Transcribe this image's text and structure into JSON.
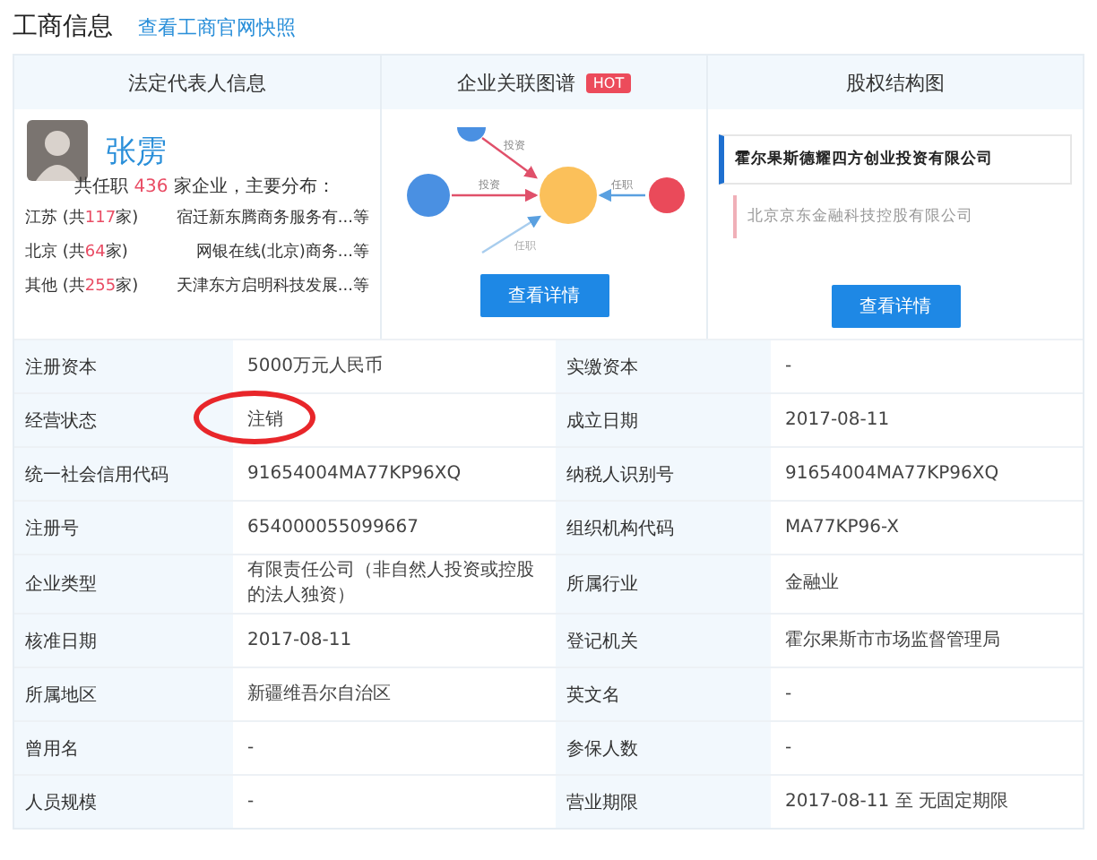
{
  "title": "工商信息",
  "snapshot_link": "查看工商官网快照",
  "panels": [
    {
      "kind": "person",
      "title": "法定代表人信息"
    },
    {
      "kind": "graph",
      "title": "企业关联图谱",
      "badge": "HOT",
      "button": "查看详情"
    },
    {
      "kind": "equity",
      "title": "股权结构图",
      "button": "查看详情"
    }
  ],
  "person": {
    "name": "张雳",
    "summary": {
      "before": "共任职",
      "count": "436",
      "after": "家企业，主要分布："
    },
    "regions": [
      {
        "region": "江苏 (共",
        "count": "117",
        "close": "家)",
        "company": "宿迁新东腾商务服务有...等"
      },
      {
        "region": "北京 (共",
        "count": "64",
        "close": "家)",
        "company": "网银在线(北京)商务...等"
      },
      {
        "region": "其他 (共",
        "count": "255",
        "close": "家)",
        "company": "天津东方启明科技发展...等"
      }
    ]
  },
  "graph": {
    "edge_labels": [
      "投资",
      "投资",
      "任职",
      "任职"
    ]
  },
  "equity": {
    "companies": [
      "霍尔果斯德耀四方创业投资有限公司",
      "北京京东金融科技控股有限公司"
    ]
  },
  "rows": [
    {
      "cells": [
        {
          "label": "注册资本",
          "value": "5000万元人民币"
        },
        {
          "label": "实缴资本",
          "value": "-"
        }
      ]
    },
    {
      "cells": [
        {
          "label": "经营状态",
          "value": "注销",
          "circled": true
        },
        {
          "label": "成立日期",
          "value": "2017-08-11"
        }
      ]
    },
    {
      "cells": [
        {
          "label": "统一社会信用代码",
          "value": "91654004MA77KP96XQ"
        },
        {
          "label": "纳税人识别号",
          "value": "91654004MA77KP96XQ"
        }
      ]
    },
    {
      "cells": [
        {
          "label": "注册号",
          "value": "654000055099667"
        },
        {
          "label": "组织机构代码",
          "value": "MA77KP96-X"
        }
      ]
    },
    {
      "cells": [
        {
          "label": "企业类型",
          "value": "有限责任公司（非自然人投资或控股的法人独资）"
        },
        {
          "label": "所属行业",
          "value": "金融业"
        }
      ]
    },
    {
      "cells": [
        {
          "label": "核准日期",
          "value": "2017-08-11"
        },
        {
          "label": "登记机关",
          "value": "霍尔果斯市市场监督管理局"
        }
      ]
    },
    {
      "cells": [
        {
          "label": "所属地区",
          "value": "新疆维吾尔自治区"
        },
        {
          "label": "英文名",
          "value": "-"
        }
      ]
    },
    {
      "cells": [
        {
          "label": "曾用名",
          "value": "-"
        },
        {
          "label": "参保人数",
          "value": "-"
        }
      ]
    },
    {
      "cells": [
        {
          "label": "人员规模",
          "value": "-"
        },
        {
          "label": "营业期限",
          "value": "2017-08-11 至 无固定期限"
        }
      ]
    }
  ]
}
